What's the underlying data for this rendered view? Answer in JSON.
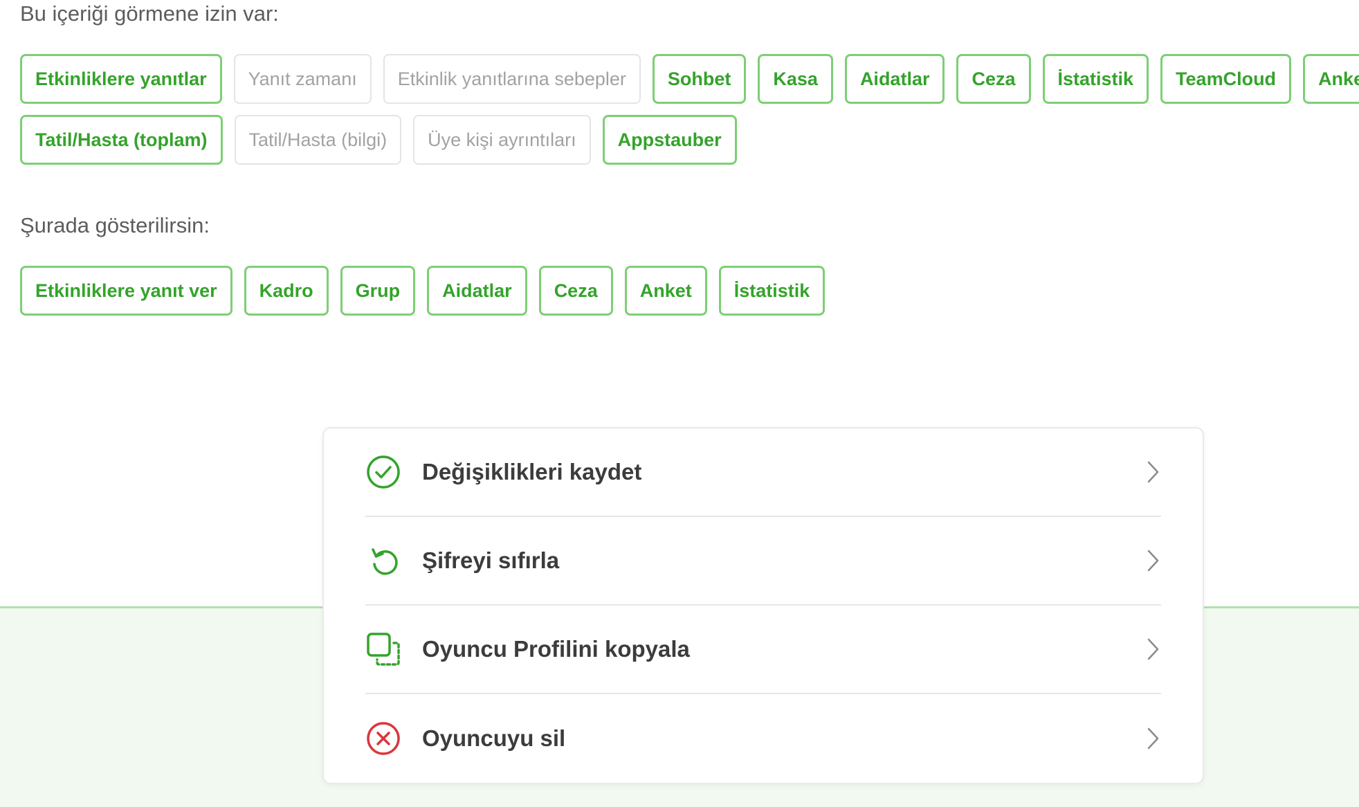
{
  "visibility": {
    "label": "Bu içeriği görmene izin var:",
    "row1": [
      {
        "label": "Etkinliklere yanıtlar",
        "active": true
      },
      {
        "label": "Yanıt zamanı",
        "active": false
      },
      {
        "label": "Etkinlik yanıtlarına sebepler",
        "active": false
      },
      {
        "label": "Sohbet",
        "active": true
      },
      {
        "label": "Kasa",
        "active": true
      },
      {
        "label": "Aidatlar",
        "active": true
      },
      {
        "label": "Ceza",
        "active": true
      },
      {
        "label": "İstatistik",
        "active": true
      },
      {
        "label": "TeamCloud",
        "active": true
      },
      {
        "label": "Anket",
        "active": true
      }
    ],
    "row2": [
      {
        "label": "Tatil/Hasta (toplam)",
        "active": true
      },
      {
        "label": "Tatil/Hasta (bilgi)",
        "active": false
      },
      {
        "label": "Üye kişi ayrıntıları",
        "active": false
      },
      {
        "label": "Appstauber",
        "active": true
      }
    ]
  },
  "shown_in": {
    "label": "Şurada gösterilirsin:",
    "items": [
      {
        "label": "Etkinliklere yanıt ver",
        "active": true
      },
      {
        "label": "Kadro",
        "active": true
      },
      {
        "label": "Grup",
        "active": true
      },
      {
        "label": "Aidatlar",
        "active": true
      },
      {
        "label": "Ceza",
        "active": true
      },
      {
        "label": "Anket",
        "active": true
      },
      {
        "label": "İstatistik",
        "active": true
      }
    ]
  },
  "actions": [
    {
      "label": "Değişiklikleri kaydet",
      "icon": "check-circle-icon",
      "color": "#34a32b"
    },
    {
      "label": "Şifreyi sıfırla",
      "icon": "reset-icon",
      "color": "#34a32b"
    },
    {
      "label": "Oyuncu Profilini kopyala",
      "icon": "copy-icon",
      "color": "#34a32b"
    },
    {
      "label": "Oyuncuyu sil",
      "icon": "delete-circle-icon",
      "color": "#d9363e"
    }
  ],
  "colors": {
    "accent": "#34a32b",
    "accent_border": "#7dcf74",
    "danger": "#d9363e",
    "footer_bg": "#f1f9f0"
  }
}
